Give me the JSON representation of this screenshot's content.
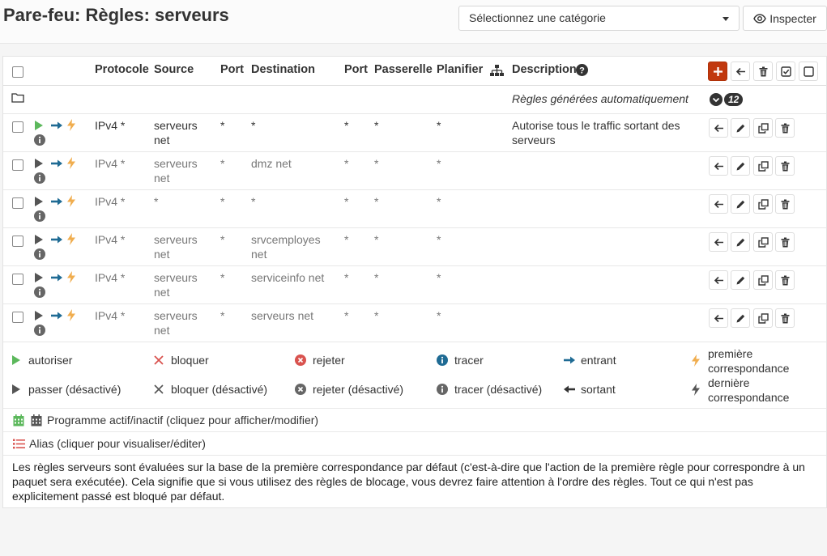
{
  "header": {
    "title": "Pare-feu: Règles: serveurs",
    "category_placeholder": "Sélectionnez une catégorie",
    "inspect_label": "Inspecter"
  },
  "table": {
    "columns": [
      "Protocole",
      "Source",
      "Port",
      "Destination",
      "Port",
      "Passerelle",
      "Planifier",
      "Description"
    ],
    "auto_rules_label": "Règles générées automatiquement",
    "auto_rules_count": "12",
    "rows": [
      {
        "protocol": "IPv4 *",
        "source_l1": "serveurs",
        "source_l2": "net",
        "port": "*",
        "destination_l1": "*",
        "destination_l2": "",
        "dport": "*",
        "gateway": "*",
        "schedule": "*",
        "description_l1": "Autorise tous le traffic sortant des",
        "description_l2": "serveurs",
        "enabled": true
      },
      {
        "protocol": "IPv4 *",
        "source_l1": "serveurs",
        "source_l2": "net",
        "port": "*",
        "destination_l1": "dmz net",
        "destination_l2": "",
        "dport": "*",
        "gateway": "*",
        "schedule": "*",
        "description_l1": "",
        "description_l2": "",
        "enabled": false
      },
      {
        "protocol": "IPv4 *",
        "source_l1": "*",
        "source_l2": "",
        "port": "*",
        "destination_l1": "*",
        "destination_l2": "",
        "dport": "*",
        "gateway": "*",
        "schedule": "*",
        "description_l1": "",
        "description_l2": "",
        "enabled": false
      },
      {
        "protocol": "IPv4 *",
        "source_l1": "serveurs",
        "source_l2": "net",
        "port": "*",
        "destination_l1": "srvcemployes",
        "destination_l2": "net",
        "dport": "*",
        "gateway": "*",
        "schedule": "*",
        "description_l1": "",
        "description_l2": "",
        "enabled": false
      },
      {
        "protocol": "IPv4 *",
        "source_l1": "serveurs",
        "source_l2": "net",
        "port": "*",
        "destination_l1": "serviceinfo net",
        "destination_l2": "",
        "dport": "*",
        "gateway": "*",
        "schedule": "*",
        "description_l1": "",
        "description_l2": "",
        "enabled": false
      },
      {
        "protocol": "IPv4 *",
        "source_l1": "serveurs",
        "source_l2": "net",
        "port": "*",
        "destination_l1": "serveurs net",
        "destination_l2": "",
        "dport": "*",
        "gateway": "*",
        "schedule": "*",
        "description_l1": "",
        "description_l2": "",
        "enabled": false
      }
    ]
  },
  "legend": {
    "allow": "autoriser",
    "block": "bloquer",
    "reject": "rejeter",
    "log": "tracer",
    "in": "entrant",
    "first_match_l1": "première",
    "first_match_l2": "correspondance",
    "pass_disabled": "passer (désactivé)",
    "block_disabled": "bloquer (désactivé)",
    "reject_disabled": "rejeter (désactivé)",
    "log_disabled": "tracer (désactivé)",
    "out": "sortant",
    "last_match_l1": "dernière",
    "last_match_l2": "correspondance",
    "schedule": "Programme actif/inactif (cliquez pour afficher/modifier)",
    "alias": "Alias (cliquer pour visualiser/éditer)"
  },
  "notice": "Les règles serveurs sont évaluées sur la base de la première correspondance par défaut (c'est-à-dire que l'action de la première règle pour correspondre à un paquet sera exécutée). Cela signifie que si vous utilisez des règles de blocage, vous devrez faire attention à l'ordre des règles. Tout ce qui n'est pas explicitement passé est bloqué par défaut.",
  "colors": {
    "green": "#5cb85c",
    "blue": "#1f6b94",
    "orange": "#f0ad4e",
    "red": "#d9534f",
    "accent": "#c1380e",
    "grey": "#666666"
  }
}
